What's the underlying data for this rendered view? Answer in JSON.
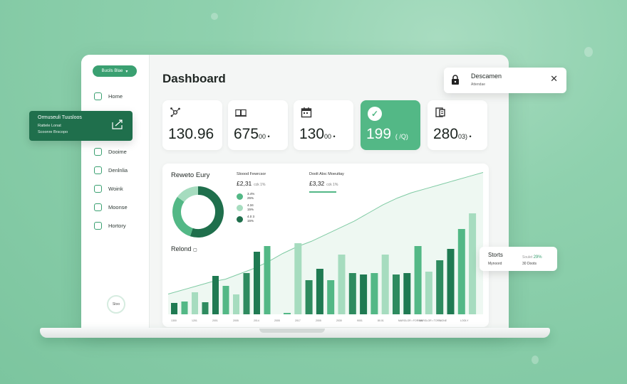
{
  "sidebar": {
    "brand": "Bucils Blae",
    "items": [
      {
        "label": "Home"
      },
      {
        "label": "Dooime"
      },
      {
        "label": "Denlnlia"
      },
      {
        "label": "Woink"
      },
      {
        "label": "Moonse"
      },
      {
        "label": "Hortory"
      }
    ],
    "toggle_label": "Stoo"
  },
  "header": {
    "title": "Dashboard"
  },
  "stats": [
    {
      "icon": "network-icon",
      "value": "130.96",
      "suffix": ""
    },
    {
      "icon": "book-icon",
      "value": "675",
      "suffix": "00 •"
    },
    {
      "icon": "calendar-icon",
      "value": "130",
      "suffix": "00 •"
    },
    {
      "icon": "check-icon",
      "value": "199",
      "suffix": "( /Q)",
      "active": true
    },
    {
      "icon": "document-icon",
      "value": "280",
      "suffix": "03) •"
    }
  ],
  "panel": {
    "title": "Reweto Eury",
    "sub1": {
      "title": "Sloood Fewrcsor",
      "value": "£2,31",
      "note": "cck 1%"
    },
    "sub2": {
      "title": "Doolt Aloc Moeuttay",
      "value": "£3,32",
      "note": "cck 1%"
    },
    "legend": [
      {
        "text1": "3.4%",
        "text2": "25%",
        "color": "#53b886"
      },
      {
        "text1": "4.34",
        "text2": "15%",
        "color": "#a6dcbf"
      },
      {
        "text1": "4.0 3",
        "text2": "15%",
        "color": "#1f6f4c"
      }
    ],
    "recent_title": "Relond"
  },
  "chart_data": {
    "type": "bar",
    "bar_groups": [
      {
        "values": [
          16,
          18,
          31,
          17,
          54,
          40,
          28,
          58,
          88,
          96
        ]
      },
      {
        "values": [
          2,
          100,
          48,
          64,
          48,
          84,
          58,
          56,
          58,
          84,
          56,
          58,
          96,
          60,
          76,
          92,
          120,
          142
        ]
      }
    ],
    "trend_line": [
      30,
      36,
      42,
      48,
      52,
      60,
      68,
      78,
      90,
      100,
      108,
      118,
      128,
      138,
      150,
      162,
      172,
      180,
      186,
      192,
      198,
      204,
      210
    ],
    "x_tick_labels": [
      "1300",
      "1201",
      "2001",
      "2005",
      "2014",
      "2005",
      "2017",
      "2005",
      "2030",
      "9001",
      "80.01",
      "MARGLOR • FORSIN",
      "MARGLOR • TORS",
      "NONE",
      "LOOLY"
    ]
  },
  "donut": [
    {
      "value": 55,
      "color": "#1f6f4c"
    },
    {
      "value": 30,
      "color": "#53b886"
    },
    {
      "value": 15,
      "color": "#a6dcbf"
    }
  ],
  "notification": {
    "title": "Descamen",
    "subtitle": "Attendae"
  },
  "floating_green": {
    "title": "Ormuseuli Tuusloos",
    "line1": "Rattele Lonat",
    "line2": "Scoonre Brscopo"
  },
  "stats_popup": {
    "title": "Storts",
    "label1": "Mynoord",
    "value1": "29%",
    "value2": "30 Doots",
    "prefix": "Soulet"
  }
}
